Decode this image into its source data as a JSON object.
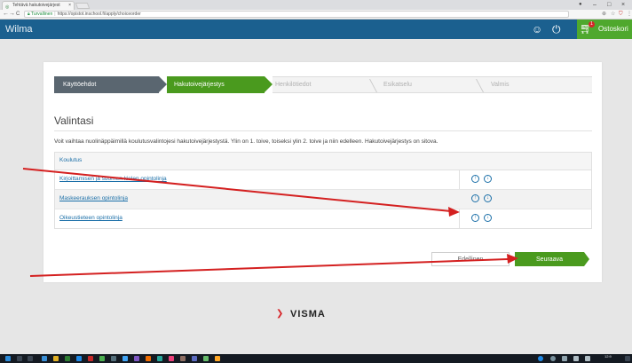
{
  "browser": {
    "tab_title": "Tehtävä hakutoivejärjest",
    "tab_close": "×",
    "url_secure_label": "Turvallinen",
    "url": "https://opistot.inschool.fi/apply/choiceorder",
    "nav_back": "←",
    "nav_forward": "→",
    "nav_reload": "C",
    "win_min": "–",
    "win_max": "□",
    "win_close": "×"
  },
  "app": {
    "brand": "Wilma",
    "cart_label": "Ostoskori",
    "cart_count": "1",
    "colors": {
      "header": "#1b608f",
      "accent_green": "#4a9a1e",
      "cart_green": "#4fa82d"
    }
  },
  "steps": [
    {
      "label": "Käyttöehdot",
      "state": "done"
    },
    {
      "label": "Hakutoivejärjestys",
      "state": "active"
    },
    {
      "label": "Henkilötiedot",
      "state": "todo"
    },
    {
      "label": "Esikatselu",
      "state": "todo"
    },
    {
      "label": "Valmis",
      "state": "todo"
    }
  ],
  "main": {
    "title": "Valintasi",
    "description": "Voit vaihtaa nuolinäppäimillä koulutusvalintojesi hakutoivejärjestystä. Ylin on 1. toive, toiseksi ylin 2. toive ja niin edelleen. Hakutoivejärjestys on sitova.",
    "table_header": "Koulutus",
    "rows": [
      {
        "label": "Kirjoittamisen ja suomen kielen opintolinja"
      },
      {
        "label": "Maskeerauksen opintolinja"
      },
      {
        "label": "Oikeustieteen opintolinja"
      }
    ],
    "up_arrow": "↑",
    "down_arrow": "↓",
    "prev_label": "Edellinen",
    "next_label": "Seuraava"
  },
  "footer": {
    "logo_text": "VISMA",
    "logo_mark_icon": "visma-chevron-icon"
  },
  "taskbar": {
    "time": "12:9"
  }
}
